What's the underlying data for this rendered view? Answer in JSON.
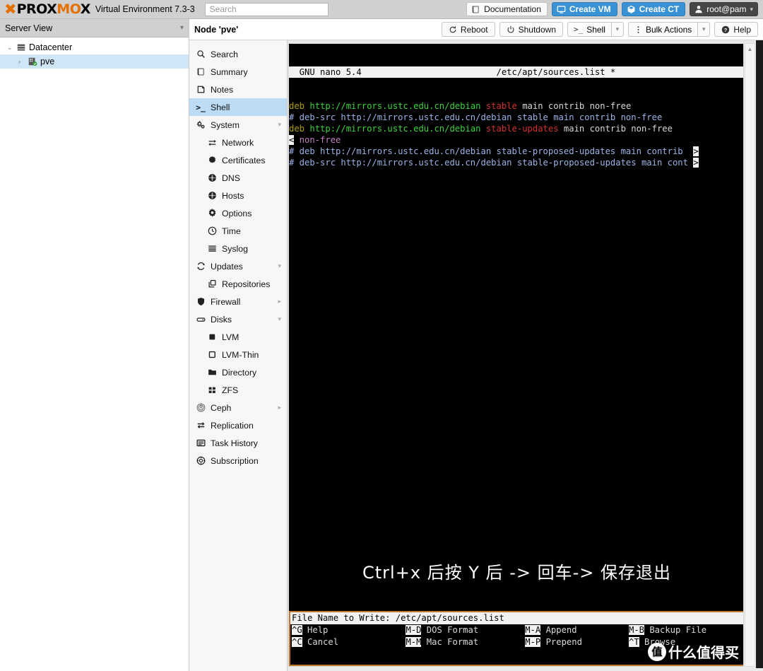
{
  "header": {
    "brand_prox": "PROX",
    "brand_mo": "MO",
    "brand_x": "X",
    "product": "Virtual Environment 7.3-3",
    "search_placeholder": "Search",
    "search_value": "",
    "documentation": "Documentation",
    "create_vm": "Create VM",
    "create_ct": "Create CT",
    "user": "root@pam"
  },
  "sidebar": {
    "view_label": "Server View",
    "tree": [
      {
        "label": "Datacenter",
        "selected": false,
        "twisty": "⌄"
      },
      {
        "label": "pve",
        "selected": true,
        "twisty": "›"
      }
    ]
  },
  "content": {
    "node_title": "Node 'pve'",
    "buttons": {
      "reboot": "Reboot",
      "shutdown": "Shutdown",
      "shell": "Shell",
      "bulk_actions": "Bulk Actions",
      "help": "Help"
    }
  },
  "nav": [
    {
      "label": "Search",
      "icon": "search-icon",
      "level": 0,
      "active": false,
      "expander": ""
    },
    {
      "label": "Summary",
      "icon": "book-icon",
      "level": 0,
      "active": false,
      "expander": ""
    },
    {
      "label": "Notes",
      "icon": "note-icon",
      "level": 0,
      "active": false,
      "expander": ""
    },
    {
      "label": "Shell",
      "icon": "terminal-icon",
      "level": 0,
      "active": true,
      "expander": ""
    },
    {
      "label": "System",
      "icon": "gears-icon",
      "level": 0,
      "active": false,
      "expander": "▾"
    },
    {
      "label": "Network",
      "icon": "network-icon",
      "level": 1,
      "active": false,
      "expander": ""
    },
    {
      "label": "Certificates",
      "icon": "certificate-icon",
      "level": 1,
      "active": false,
      "expander": ""
    },
    {
      "label": "DNS",
      "icon": "globe-icon",
      "level": 1,
      "active": false,
      "expander": ""
    },
    {
      "label": "Hosts",
      "icon": "globe-icon",
      "level": 1,
      "active": false,
      "expander": ""
    },
    {
      "label": "Options",
      "icon": "gear-icon",
      "level": 1,
      "active": false,
      "expander": ""
    },
    {
      "label": "Time",
      "icon": "clock-icon",
      "level": 1,
      "active": false,
      "expander": ""
    },
    {
      "label": "Syslog",
      "icon": "list-icon",
      "level": 1,
      "active": false,
      "expander": ""
    },
    {
      "label": "Updates",
      "icon": "refresh-icon",
      "level": 0,
      "active": false,
      "expander": "▾"
    },
    {
      "label": "Repositories",
      "icon": "copy-icon",
      "level": 1,
      "active": false,
      "expander": ""
    },
    {
      "label": "Firewall",
      "icon": "shield-icon",
      "level": 0,
      "active": false,
      "expander": "▸"
    },
    {
      "label": "Disks",
      "icon": "disk-icon",
      "level": 0,
      "active": false,
      "expander": "▾"
    },
    {
      "label": "LVM",
      "icon": "square-filled-icon",
      "level": 1,
      "active": false,
      "expander": ""
    },
    {
      "label": "LVM-Thin",
      "icon": "square-outline-icon",
      "level": 1,
      "active": false,
      "expander": ""
    },
    {
      "label": "Directory",
      "icon": "folder-icon",
      "level": 1,
      "active": false,
      "expander": ""
    },
    {
      "label": "ZFS",
      "icon": "grid-icon",
      "level": 1,
      "active": false,
      "expander": ""
    },
    {
      "label": "Ceph",
      "icon": "ceph-icon",
      "level": 0,
      "active": false,
      "expander": "▸"
    },
    {
      "label": "Replication",
      "icon": "replication-icon",
      "level": 0,
      "active": false,
      "expander": ""
    },
    {
      "label": "Task History",
      "icon": "history-icon",
      "level": 0,
      "active": false,
      "expander": ""
    },
    {
      "label": "Subscription",
      "icon": "subscription-icon",
      "level": 0,
      "active": false,
      "expander": ""
    }
  ],
  "terminal": {
    "nano_title_left": "  GNU nano 5.4",
    "nano_title_file": "/etc/apt/sources.list *",
    "lines": [
      {
        "segments": [
          {
            "text": "deb",
            "color": "yellow"
          },
          {
            "text": " http://mirrors.ustc.edu.cn/debian",
            "color": "green"
          },
          {
            "text": " stable",
            "color": "red"
          },
          {
            "text": " main contrib non-free",
            "color": "white"
          }
        ]
      },
      {
        "segments": [
          {
            "text": "# deb-src http://mirrors.ustc.edu.cn/debian stable main contrib non-free",
            "color": "blue"
          }
        ]
      },
      {
        "segments": [
          {
            "text": "deb",
            "color": "yellow"
          },
          {
            "text": " http://mirrors.ustc.edu.cn/debian",
            "color": "green"
          },
          {
            "text": " stable-updates",
            "color": "red"
          },
          {
            "text": " main contrib non-free",
            "color": "white"
          }
        ]
      },
      {
        "wrap_marker_left": "<",
        "segments": [
          {
            "text": " non-free",
            "color": "magenta"
          }
        ]
      },
      {
        "wrap_marker_right": ">",
        "segments": [
          {
            "text": "# deb http://mirrors.ustc.edu.cn/debian stable-proposed-updates main contrib",
            "color": "blue"
          }
        ]
      },
      {
        "wrap_marker_right": ">",
        "segments": [
          {
            "text": "# deb-src http://mirrors.ustc.edu.cn/debian stable-proposed-updates main cont",
            "color": "blue"
          }
        ]
      }
    ],
    "overlay_text": "Ctrl+x 后按 Y 后 -> 回车-> 保存退出",
    "prompt": "File Name to Write: /etc/apt/sources.list",
    "shortcuts_row1": [
      {
        "key": "^G",
        "label": "Help"
      },
      {
        "key": "M-D",
        "label": "DOS Format"
      },
      {
        "key": "M-A",
        "label": "Append"
      },
      {
        "key": "M-B",
        "label": "Backup File"
      }
    ],
    "shortcuts_row2": [
      {
        "key": "^C",
        "label": "Cancel"
      },
      {
        "key": "M-M",
        "label": "Mac Format"
      },
      {
        "key": "M-P",
        "label": "Prepend"
      },
      {
        "key": "^T",
        "label": "Browse"
      }
    ]
  },
  "watermark": {
    "logo_char": "值",
    "text": "什么值得买"
  },
  "colors": {
    "accent_orange": "#e57000",
    "blue_button": "#3892d4",
    "nav_active": "#bcdcf5",
    "tree_selected": "#cfe6f7",
    "nano_border": "#c07830"
  }
}
